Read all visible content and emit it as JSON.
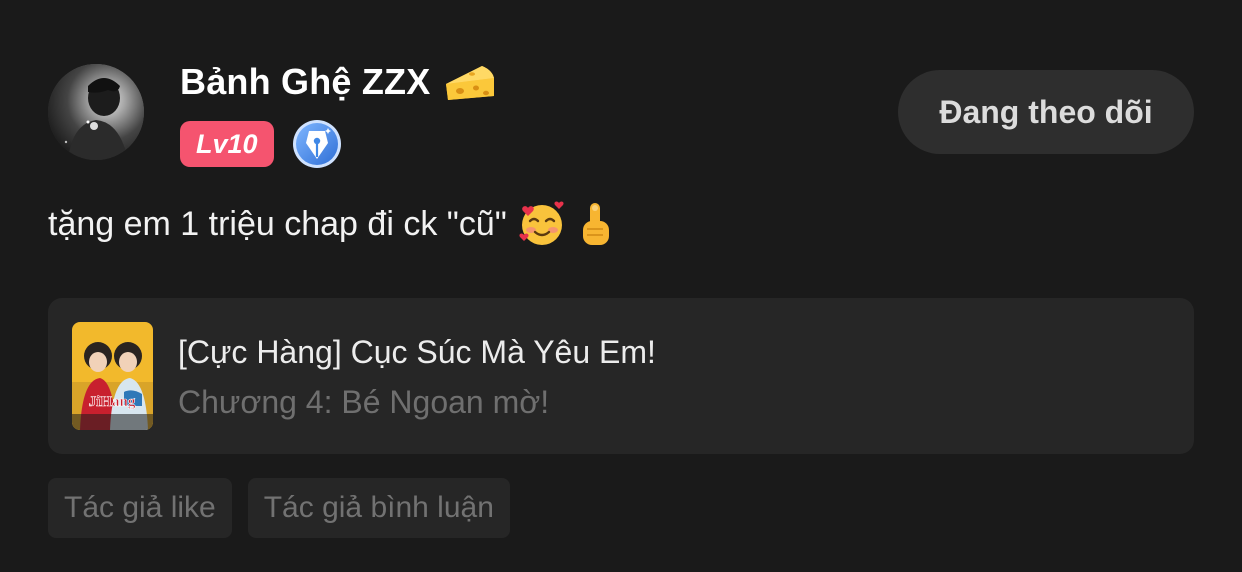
{
  "user": {
    "name": "Bảnh Ghệ ZZX",
    "name_icon": "cheese-icon",
    "level": "Lv10",
    "author_badge_icon": "pen-nib-icon",
    "avatar_icon": "avatar-photo"
  },
  "follow_button": {
    "label": "Đang theo dõi"
  },
  "comment": {
    "text": "tặng em 1 triệu chap đi ck \"cũ\"",
    "emojis": [
      "smiling-face-with-hearts-icon",
      "pointing-up-finger-icon"
    ]
  },
  "chapter": {
    "title": "[Cực Hàng] Cục Súc Mà Yêu Em!",
    "subtitle": "Chương 4: Bé Ngoan mờ!",
    "cover_icon": "comic-cover-thumbnail"
  },
  "tags": [
    {
      "label": "Tác giả like"
    },
    {
      "label": "Tác giả bình luận"
    }
  ],
  "colors": {
    "background": "#1a1a1a",
    "card": "#262626",
    "level_badge": "#f5546f",
    "pen_badge": "#3f88e6",
    "muted_text": "#6f6f6f"
  }
}
